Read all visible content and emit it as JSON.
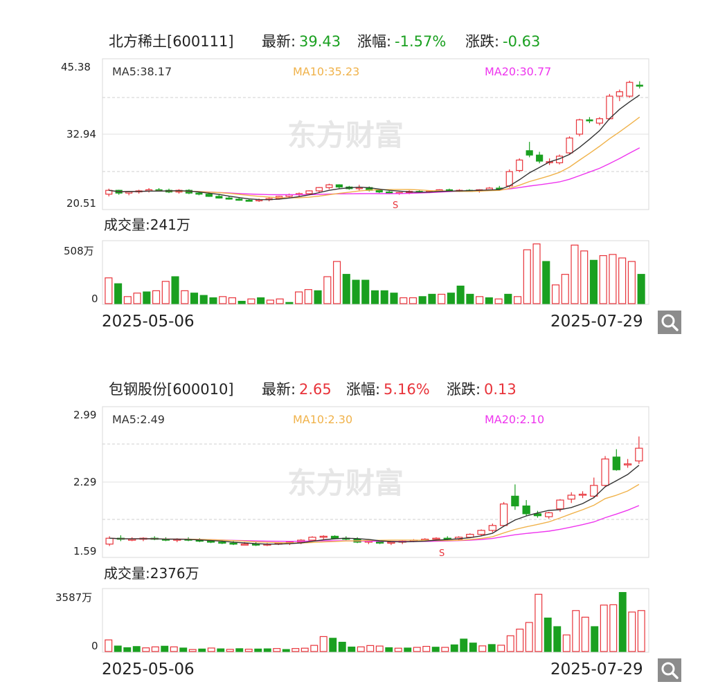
{
  "watermark": "东方财富",
  "colors": {
    "up": "#e8333a",
    "down": "#1aa020",
    "ma5": "#333333",
    "ma10": "#f0b24a",
    "ma20": "#ee35ee"
  },
  "stocks": [
    {
      "name": "北方稀土[600111]",
      "latest_label": "最新:",
      "latest": "39.43",
      "change_pct_label": "涨幅:",
      "change_pct": "-1.57%",
      "change_label": "涨跌:",
      "change": "-0.63",
      "direction": "down",
      "ma5": "MA5:38.17",
      "ma10": "MA10:35.23",
      "ma20": "MA20:30.77",
      "price_ticks": [
        "45.38",
        "32.94",
        "20.51"
      ],
      "volume_label": "成交量:241万",
      "volume_ticks": [
        "508万",
        "0"
      ],
      "start_date": "2025-05-06",
      "end_date": "2025-07-29",
      "marker": "S"
    },
    {
      "name": "包钢股份[600010]",
      "latest_label": "最新:",
      "latest": "2.65",
      "change_pct_label": "涨幅:",
      "change_pct": "5.16%",
      "change_label": "涨跌:",
      "change": "0.13",
      "direction": "up",
      "ma5": "MA5:2.49",
      "ma10": "MA10:2.30",
      "ma20": "MA20:2.10",
      "price_ticks": [
        "2.99",
        "2.29",
        "1.59"
      ],
      "volume_label": "成交量:2376万",
      "volume_ticks": [
        "3587万",
        "0"
      ],
      "start_date": "2025-05-06",
      "end_date": "2025-07-29",
      "marker": "S"
    }
  ],
  "chart_data": [
    {
      "type": "candlestick",
      "title": "北方稀土[600111]",
      "ylim": [
        20.51,
        45.38
      ],
      "volume_unit": "万",
      "volume_max": 508,
      "x_range": [
        "2025-05-06",
        "2025-07-29"
      ],
      "ohlc": [
        [
          22.3,
          23.3,
          21.9,
          23.0
        ],
        [
          23.0,
          23.1,
          22.2,
          22.5
        ],
        [
          22.5,
          22.9,
          22.1,
          22.8
        ],
        [
          22.8,
          23.1,
          22.4,
          22.9
        ],
        [
          22.9,
          23.4,
          22.6,
          23.1
        ],
        [
          23.1,
          23.4,
          22.8,
          23.0
        ],
        [
          23.0,
          23.3,
          22.5,
          22.7
        ],
        [
          22.7,
          23.2,
          22.4,
          23.0
        ],
        [
          23.0,
          23.2,
          22.3,
          22.5
        ],
        [
          22.5,
          22.7,
          22.1,
          22.3
        ],
        [
          22.3,
          22.6,
          21.8,
          21.9
        ],
        [
          21.9,
          22.2,
          21.5,
          21.6
        ],
        [
          21.6,
          21.9,
          21.3,
          21.4
        ],
        [
          21.4,
          21.7,
          21.1,
          21.2
        ],
        [
          21.2,
          21.5,
          21.0,
          21.1
        ],
        [
          21.1,
          21.5,
          20.9,
          21.3
        ],
        [
          21.3,
          21.7,
          21.0,
          21.5
        ],
        [
          21.5,
          22.0,
          21.3,
          21.9
        ],
        [
          21.9,
          22.4,
          21.6,
          22.2
        ],
        [
          22.2,
          22.6,
          21.9,
          22.4
        ],
        [
          22.4,
          23.0,
          22.2,
          22.9
        ],
        [
          22.9,
          23.6,
          22.6,
          23.5
        ],
        [
          23.5,
          24.2,
          23.2,
          24.0
        ],
        [
          24.0,
          24.1,
          23.3,
          23.6
        ],
        [
          23.6,
          23.8,
          23.1,
          23.3
        ],
        [
          23.3,
          24.0,
          23.0,
          23.5
        ],
        [
          23.5,
          23.7,
          22.8,
          23.0
        ],
        [
          23.0,
          23.2,
          22.5,
          22.7
        ],
        [
          22.7,
          22.9,
          22.3,
          22.5
        ],
        [
          22.5,
          22.7,
          22.2,
          22.6
        ],
        [
          22.6,
          23.0,
          22.3,
          22.8
        ],
        [
          22.8,
          23.0,
          22.5,
          22.7
        ],
        [
          22.7,
          22.9,
          22.5,
          22.8
        ],
        [
          22.8,
          23.2,
          22.6,
          23.1
        ],
        [
          23.1,
          23.3,
          22.7,
          22.9
        ],
        [
          22.9,
          23.2,
          22.7,
          23.0
        ],
        [
          23.0,
          23.2,
          22.8,
          22.9
        ],
        [
          22.9,
          23.2,
          22.6,
          23.1
        ],
        [
          23.1,
          23.6,
          22.9,
          23.4
        ],
        [
          23.4,
          23.8,
          23.0,
          23.2
        ],
        [
          23.8,
          26.8,
          23.5,
          26.4
        ],
        [
          26.6,
          28.8,
          26.3,
          28.5
        ],
        [
          30.2,
          31.8,
          29.0,
          29.4
        ],
        [
          29.4,
          30.0,
          27.9,
          28.3
        ],
        [
          28.1,
          28.8,
          27.6,
          28.2
        ],
        [
          28.0,
          29.5,
          27.7,
          29.2
        ],
        [
          29.8,
          32.8,
          29.5,
          32.5
        ],
        [
          33.2,
          36.0,
          32.8,
          35.8
        ],
        [
          35.8,
          36.3,
          35.2,
          35.7
        ],
        [
          35.2,
          36.3,
          34.8,
          36.0
        ],
        [
          36.0,
          40.5,
          35.8,
          40.1
        ],
        [
          40.1,
          41.3,
          39.2,
          40.9
        ],
        [
          40.1,
          42.9,
          39.8,
          42.6
        ],
        [
          42.1,
          42.8,
          41.5,
          42.0
        ]
      ],
      "volume": [
        220,
        170,
        60,
        90,
        100,
        110,
        190,
        230,
        110,
        90,
        70,
        50,
        60,
        50,
        20,
        40,
        50,
        30,
        40,
        10,
        100,
        120,
        110,
        230,
        360,
        250,
        200,
        200,
        110,
        110,
        90,
        50,
        50,
        60,
        80,
        80,
        90,
        150,
        80,
        60,
        50,
        40,
        80,
        60,
        460,
        510,
        360,
        160,
        250,
        500,
        450,
        370,
        410,
        420,
        390,
        360,
        250
      ],
      "volume_dir": [
        "up",
        "down",
        "up",
        "up",
        "down",
        "up",
        "up",
        "down",
        "up",
        "down",
        "down",
        "down",
        "up",
        "up",
        "down",
        "up",
        "down",
        "up",
        "up",
        "down",
        "up",
        "up",
        "down",
        "up",
        "up",
        "down",
        "down",
        "down",
        "down",
        "down",
        "down",
        "up",
        "up",
        "down",
        "down",
        "up",
        "down",
        "down",
        "down",
        "up",
        "down",
        "up",
        "down",
        "up",
        "up",
        "up",
        "down",
        "up",
        "up",
        "up",
        "up",
        "down",
        "up",
        "up",
        "up",
        "up",
        "down"
      ],
      "ma5_end": 38.17,
      "ma10_end": 35.23,
      "ma20_end": 30.77
    },
    {
      "type": "candlestick",
      "title": "包钢股份[600010]",
      "ylim": [
        1.59,
        2.99
      ],
      "volume_unit": "万",
      "volume_max": 3587,
      "x_range": [
        "2025-05-06",
        "2025-07-29"
      ],
      "ohlc": [
        [
          1.67,
          1.75,
          1.65,
          1.73
        ],
        [
          1.73,
          1.76,
          1.7,
          1.72
        ],
        [
          1.72,
          1.74,
          1.7,
          1.72
        ],
        [
          1.72,
          1.74,
          1.7,
          1.73
        ],
        [
          1.73,
          1.75,
          1.71,
          1.72
        ],
        [
          1.72,
          1.74,
          1.7,
          1.71
        ],
        [
          1.71,
          1.73,
          1.69,
          1.72
        ],
        [
          1.72,
          1.74,
          1.7,
          1.71
        ],
        [
          1.71,
          1.73,
          1.69,
          1.7
        ],
        [
          1.7,
          1.72,
          1.68,
          1.69
        ],
        [
          1.69,
          1.71,
          1.67,
          1.68
        ],
        [
          1.68,
          1.7,
          1.66,
          1.67
        ],
        [
          1.67,
          1.69,
          1.66,
          1.67
        ],
        [
          1.67,
          1.69,
          1.65,
          1.66
        ],
        [
          1.66,
          1.68,
          1.65,
          1.67
        ],
        [
          1.67,
          1.69,
          1.66,
          1.68
        ],
        [
          1.68,
          1.7,
          1.66,
          1.69
        ],
        [
          1.69,
          1.72,
          1.67,
          1.71
        ],
        [
          1.71,
          1.75,
          1.7,
          1.74
        ],
        [
          1.74,
          1.76,
          1.72,
          1.75
        ],
        [
          1.75,
          1.76,
          1.72,
          1.73
        ],
        [
          1.73,
          1.75,
          1.71,
          1.72
        ],
        [
          1.72,
          1.74,
          1.68,
          1.69
        ],
        [
          1.69,
          1.71,
          1.67,
          1.7
        ],
        [
          1.7,
          1.71,
          1.67,
          1.68
        ],
        [
          1.68,
          1.7,
          1.66,
          1.69
        ],
        [
          1.69,
          1.71,
          1.67,
          1.7
        ],
        [
          1.7,
          1.72,
          1.69,
          1.71
        ],
        [
          1.71,
          1.73,
          1.7,
          1.72
        ],
        [
          1.72,
          1.74,
          1.7,
          1.73
        ],
        [
          1.73,
          1.75,
          1.71,
          1.72
        ],
        [
          1.72,
          1.75,
          1.71,
          1.74
        ],
        [
          1.74,
          1.78,
          1.73,
          1.77
        ],
        [
          1.77,
          1.82,
          1.75,
          1.81
        ],
        [
          1.81,
          1.88,
          1.79,
          1.86
        ],
        [
          1.86,
          2.1,
          1.85,
          2.08
        ],
        [
          2.16,
          2.28,
          2.02,
          2.06
        ],
        [
          2.06,
          2.12,
          1.96,
          1.98
        ],
        [
          1.98,
          2.01,
          1.94,
          1.96
        ],
        [
          1.95,
          2.0,
          1.93,
          1.99
        ],
        [
          2.03,
          2.13,
          2.0,
          2.12
        ],
        [
          2.13,
          2.2,
          2.09,
          2.17
        ],
        [
          2.18,
          2.21,
          2.14,
          2.18
        ],
        [
          2.16,
          2.35,
          2.14,
          2.27
        ],
        [
          2.27,
          2.57,
          2.25,
          2.54
        ],
        [
          2.56,
          2.64,
          2.42,
          2.43
        ],
        [
          2.48,
          2.54,
          2.45,
          2.49
        ],
        [
          2.52,
          2.77,
          2.49,
          2.65
        ]
      ],
      "volume": [
        700,
        330,
        230,
        300,
        220,
        280,
        320,
        280,
        210,
        120,
        150,
        210,
        160,
        130,
        170,
        140,
        150,
        160,
        180,
        120,
        180,
        200,
        370,
        900,
        800,
        560,
        270,
        280,
        360,
        330,
        230,
        200,
        210,
        250,
        310,
        260,
        250,
        400,
        750,
        510,
        340,
        420,
        380,
        950,
        1350,
        1750,
        3450,
        2020,
        1500,
        1000,
        2470,
        2070,
        1500,
        2800,
        2820,
        3560,
        2380,
        2470
      ],
      "volume_dir": [
        "up",
        "down",
        "down",
        "down",
        "up",
        "up",
        "down",
        "up",
        "down",
        "up",
        "down",
        "up",
        "down",
        "up",
        "down",
        "up",
        "down",
        "down",
        "up",
        "down",
        "up",
        "up",
        "up",
        "up",
        "down",
        "down",
        "down",
        "up",
        "up",
        "up",
        "down",
        "up",
        "down",
        "up",
        "up",
        "down",
        "up",
        "down",
        "down",
        "down",
        "up",
        "down",
        "up",
        "up",
        "up",
        "up",
        "up",
        "down",
        "down",
        "up",
        "up",
        "up",
        "down",
        "up",
        "up",
        "down",
        "up",
        "up"
      ],
      "ma5_end": 2.49,
      "ma10_end": 2.3,
      "ma20_end": 2.1
    }
  ]
}
